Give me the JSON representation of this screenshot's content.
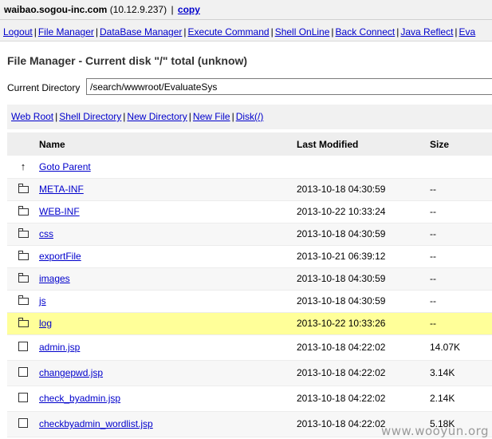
{
  "header": {
    "host": "waibao.sogou-inc.com",
    "ip": "(10.12.9.237)",
    "separator": "|",
    "copy_label": "copy"
  },
  "nav": {
    "items": [
      {
        "label": "Logout"
      },
      {
        "label": "File Manager"
      },
      {
        "label": "DataBase Manager"
      },
      {
        "label": "Execute Command"
      },
      {
        "label": "Shell OnLine"
      },
      {
        "label": "Back Connect"
      },
      {
        "label": "Java Reflect"
      },
      {
        "label": "Eva"
      }
    ]
  },
  "page": {
    "title": "File Manager - Current disk \"/\" total (unknow)",
    "current_dir_label": "Current Directory",
    "current_dir_value": "/search/wwwroot/EvaluateSys"
  },
  "links": {
    "items": [
      {
        "label": "Web Root"
      },
      {
        "label": "Shell Directory"
      },
      {
        "label": "New Directory"
      },
      {
        "label": "New File"
      },
      {
        "label": "Disk(/)"
      }
    ]
  },
  "table": {
    "headers": {
      "name": "Name",
      "modified": "Last Modified",
      "size": "Size"
    },
    "rows": [
      {
        "icon": "up-arrow-icon",
        "glyph": "↑",
        "name": "Goto Parent",
        "modified": "",
        "size": ""
      },
      {
        "icon": "folder-icon",
        "name": "META-INF",
        "modified": "2013-10-18 04:30:59",
        "size": "--"
      },
      {
        "icon": "folder-icon",
        "name": "WEB-INF",
        "modified": "2013-10-22 10:33:24",
        "size": "--"
      },
      {
        "icon": "folder-icon",
        "name": "css",
        "modified": "2013-10-18 04:30:59",
        "size": "--"
      },
      {
        "icon": "folder-icon",
        "name": "exportFile",
        "modified": "2013-10-21 06:39:12",
        "size": "--"
      },
      {
        "icon": "folder-icon",
        "name": "images",
        "modified": "2013-10-18 04:30:59",
        "size": "--"
      },
      {
        "icon": "folder-icon",
        "name": "js",
        "modified": "2013-10-18 04:30:59",
        "size": "--"
      },
      {
        "icon": "folder-icon",
        "name": "log",
        "modified": "2013-10-22 10:33:26",
        "size": "--",
        "highlighted": true
      },
      {
        "icon": "file-icon",
        "name": "admin.jsp",
        "modified": "2013-10-18 04:22:02",
        "size": "14.07K"
      },
      {
        "icon": "file-icon",
        "name": "changepwd.jsp",
        "modified": "2013-10-18 04:22:02",
        "size": "3.14K"
      },
      {
        "icon": "file-icon",
        "name": "check_byadmin.jsp",
        "modified": "2013-10-18 04:22:02",
        "size": "2.14K"
      },
      {
        "icon": "file-icon",
        "name": "checkbyadmin_wordlist.jsp",
        "modified": "2013-10-18 04:22:02",
        "size": "5.18K"
      }
    ]
  },
  "colors": {
    "link": "#0000cc",
    "highlight_row": "#ffff99",
    "bar_bg": "#f1f1f1"
  },
  "watermark": "www.wooyun.org"
}
